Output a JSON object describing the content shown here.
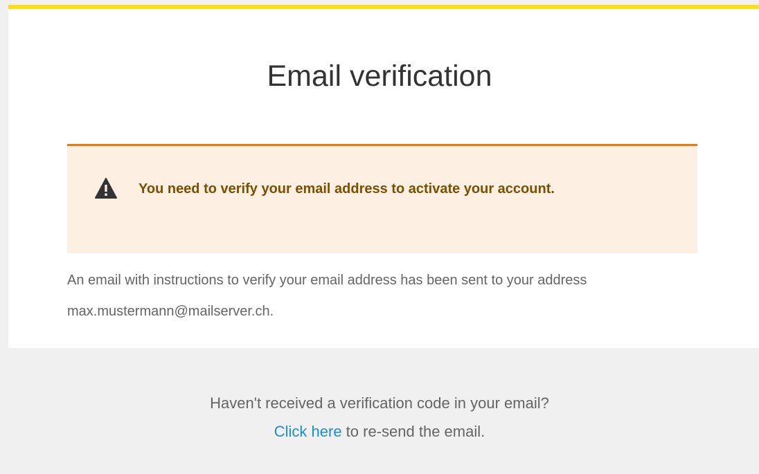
{
  "page": {
    "title": "Email verification"
  },
  "alert": {
    "icon": "warning-triangle-icon",
    "message": "You need to verify your email address to activate your account."
  },
  "info": {
    "message": "An email with instructions to verify your email address has been sent to your address max.mustermann@mailserver.ch."
  },
  "footer": {
    "question": "Haven't received a verification code in your email?",
    "link_label": "Click here",
    "link_suffix": " to re-send the email."
  },
  "colors": {
    "accent_top_bar": "#f7e016",
    "alert_border": "#ec7a08",
    "alert_background": "#feefe3",
    "alert_text": "#7a4f00",
    "link": "#1a8fce"
  }
}
